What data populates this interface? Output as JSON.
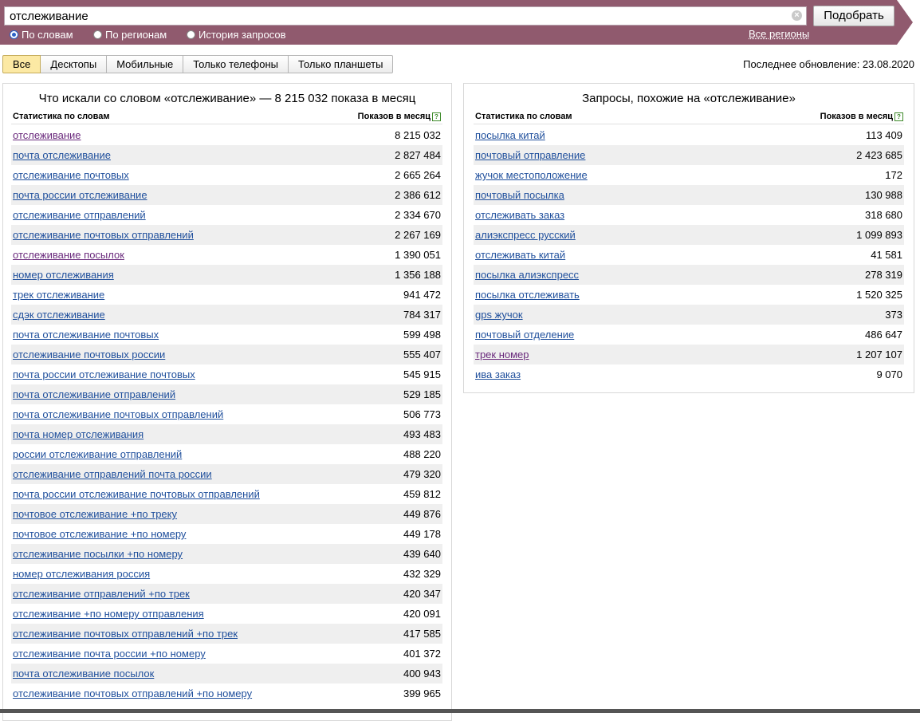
{
  "search": {
    "value": "отслеживание",
    "button_label": "Подобрать",
    "radios": [
      {
        "label": "По словам",
        "selected": true
      },
      {
        "label": "По регионам",
        "selected": false
      },
      {
        "label": "История запросов",
        "selected": false
      }
    ],
    "regions_link": "Все регионы"
  },
  "tabs": [
    {
      "label": "Все",
      "active": true
    },
    {
      "label": "Десктопы",
      "active": false
    },
    {
      "label": "Мобильные",
      "active": false
    },
    {
      "label": "Только телефоны",
      "active": false
    },
    {
      "label": "Только планшеты",
      "active": false
    }
  ],
  "updated": "Последнее обновление: 23.08.2020",
  "left_panel": {
    "title": "Что искали со словом «отслеживание» — 8 215 032 показа в месяц",
    "col_words": "Статистика по словам",
    "col_shows": "Показов в месяц",
    "rows": [
      {
        "phrase": "отслеживание",
        "count": "8 215 032",
        "visited": true
      },
      {
        "phrase": "почта отслеживание",
        "count": "2 827 484"
      },
      {
        "phrase": "отслеживание почтовых",
        "count": "2 665 264"
      },
      {
        "phrase": "почта россии отслеживание",
        "count": "2 386 612"
      },
      {
        "phrase": "отслеживание отправлений",
        "count": "2 334 670"
      },
      {
        "phrase": "отслеживание почтовых отправлений",
        "count": "2 267 169"
      },
      {
        "phrase": "отслеживание посылок",
        "count": "1 390 051",
        "visited": true
      },
      {
        "phrase": "номер отслеживания",
        "count": "1 356 188"
      },
      {
        "phrase": "трек отслеживание",
        "count": "941 472"
      },
      {
        "phrase": "сдэк отслеживание",
        "count": "784 317"
      },
      {
        "phrase": "почта отслеживание почтовых",
        "count": "599 498"
      },
      {
        "phrase": "отслеживание почтовых россии",
        "count": "555 407"
      },
      {
        "phrase": "почта россии отслеживание почтовых",
        "count": "545 915"
      },
      {
        "phrase": "почта отслеживание отправлений",
        "count": "529 185"
      },
      {
        "phrase": "почта отслеживание почтовых отправлений",
        "count": "506 773"
      },
      {
        "phrase": "почта номер отслеживания",
        "count": "493 483"
      },
      {
        "phrase": "россии отслеживание отправлений",
        "count": "488 220"
      },
      {
        "phrase": "отслеживание отправлений почта россии",
        "count": "479 320"
      },
      {
        "phrase": "почта россии отслеживание почтовых отправлений",
        "count": "459 812"
      },
      {
        "phrase": "почтовое отслеживание +по треку",
        "count": "449 876"
      },
      {
        "phrase": "почтовое отслеживание +по номеру",
        "count": "449 178"
      },
      {
        "phrase": "отслеживание посылки +по номеру",
        "count": "439 640"
      },
      {
        "phrase": "номер отслеживания россия",
        "count": "432 329"
      },
      {
        "phrase": "отслеживание отправлений +по трек",
        "count": "420 347"
      },
      {
        "phrase": "отслеживание +по номеру отправления",
        "count": "420 091"
      },
      {
        "phrase": "отслеживание почтовых отправлений +по трек",
        "count": "417 585"
      },
      {
        "phrase": "отслеживание почта россии +по номеру",
        "count": "401 372"
      },
      {
        "phrase": "почта отслеживание посылок",
        "count": "400 943"
      },
      {
        "phrase": "отслеживание почтовых отправлений +по номеру",
        "count": "399 965"
      }
    ]
  },
  "right_panel": {
    "title": "Запросы, похожие на «отслеживание»",
    "col_words": "Статистика по словам",
    "col_shows": "Показов в месяц",
    "rows": [
      {
        "phrase": "посылка китай",
        "count": "113 409"
      },
      {
        "phrase": "почтовый отправление",
        "count": "2 423 685"
      },
      {
        "phrase": "жучок местоположение",
        "count": "172"
      },
      {
        "phrase": "почтовый посылка",
        "count": "130 988"
      },
      {
        "phrase": "отслеживать заказ",
        "count": "318 680"
      },
      {
        "phrase": "алиэкспресс русский",
        "count": "1 099 893"
      },
      {
        "phrase": "отслеживать китай",
        "count": "41 581"
      },
      {
        "phrase": "посылка алиэкспресс",
        "count": "278 319"
      },
      {
        "phrase": "посылка отслеживать",
        "count": "1 520 325"
      },
      {
        "phrase": "gps жучок",
        "count": "373"
      },
      {
        "phrase": "почтовый отделение",
        "count": "486 647"
      },
      {
        "phrase": "трек номер",
        "count": "1 207 107",
        "visited": true
      },
      {
        "phrase": "ива заказ",
        "count": "9 070"
      }
    ]
  },
  "colors": {
    "band": "#905a6e",
    "link": "#1f4f9c",
    "visited_link": "#6a2a7c",
    "active_tab": "#fce9a4",
    "row_alt": "#efefef"
  }
}
